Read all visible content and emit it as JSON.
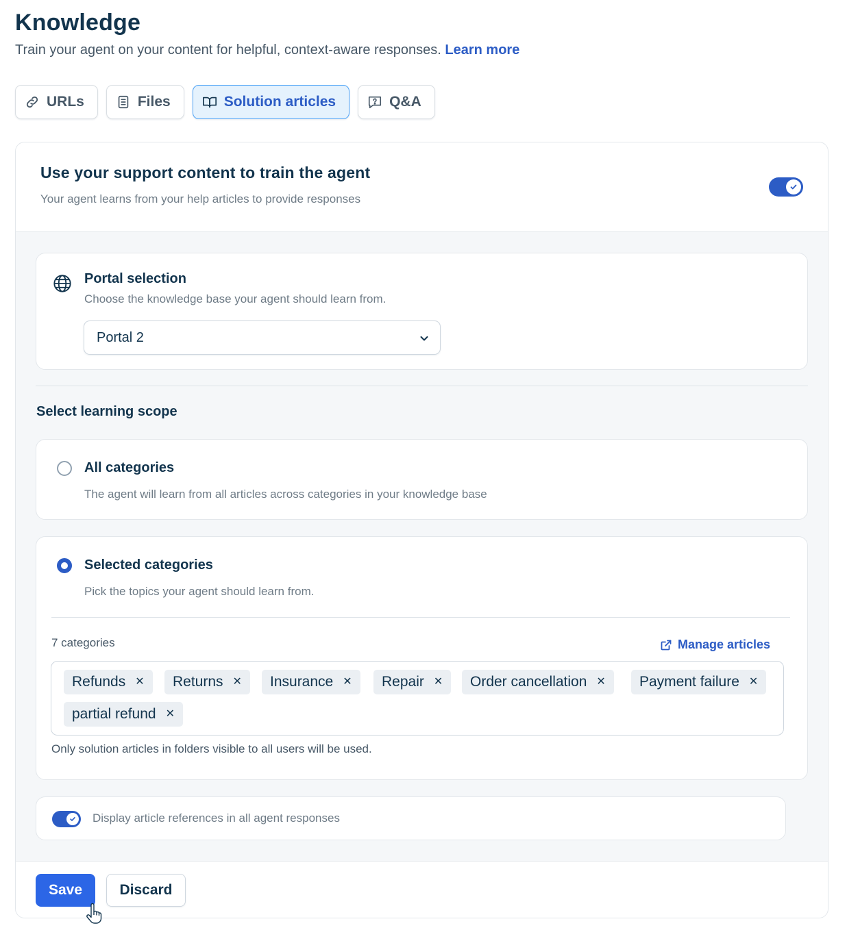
{
  "header": {
    "title": "Knowledge",
    "subtitle": "Train your agent on your content for helpful, context-aware responses.",
    "learn_more": "Learn more"
  },
  "tabs": [
    {
      "label": "URLs",
      "icon": "link-icon",
      "active": false
    },
    {
      "label": "Files",
      "icon": "file-icon",
      "active": false
    },
    {
      "label": "Solution articles",
      "icon": "book-icon",
      "active": true
    },
    {
      "label": "Q&A",
      "icon": "chat-question-icon",
      "active": false
    }
  ],
  "support": {
    "title": "Use your support content to train the agent",
    "description": "Your agent learns from your help articles to provide responses",
    "enabled": true
  },
  "portal": {
    "title": "Portal selection",
    "description": "Choose the knowledge base your agent should learn from.",
    "selected": "Portal 2"
  },
  "scope": {
    "heading": "Select learning scope",
    "all": {
      "title": "All categories",
      "description": "The agent will learn from all articles across categories in your knowledge base",
      "selected": false
    },
    "selected": {
      "title": "Selected categories",
      "description": "Pick the topics your agent should learn from.",
      "selected": true,
      "count_label": "7 categories",
      "manage_label": "Manage articles",
      "categories": [
        "Refunds",
        "Returns",
        "Insurance",
        "Repair",
        "Order cancellation",
        "Payment failure",
        "partial refund"
      ],
      "note": "Only solution articles in folders visible to all users will be used."
    }
  },
  "references": {
    "label": "Display article references in all agent responses",
    "enabled": true
  },
  "footer": {
    "save_label": "Save",
    "discard_label": "Discard"
  },
  "colors": {
    "primary": "#2c5cc5",
    "text": "#12344d",
    "muted": "#6f7c87",
    "active_tab_bg": "#e5f2fd"
  }
}
